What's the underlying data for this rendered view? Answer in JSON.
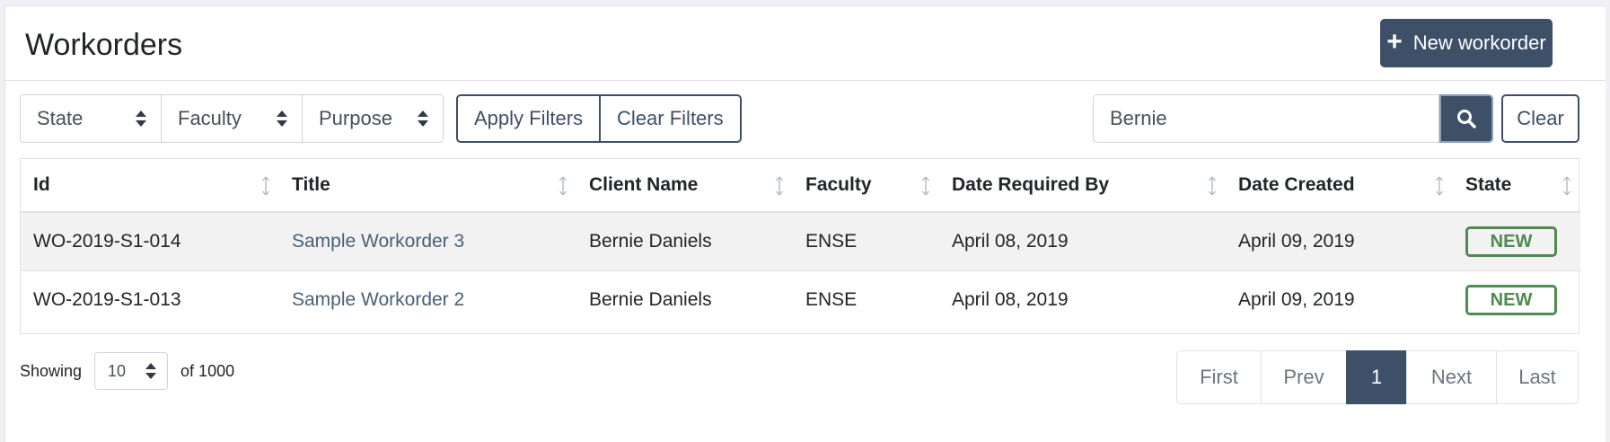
{
  "header": {
    "title": "Workorders",
    "new_button": "New workorder"
  },
  "filters": {
    "state": "State",
    "faculty": "Faculty",
    "purpose": "Purpose",
    "apply": "Apply Filters",
    "clear": "Clear Filters"
  },
  "search": {
    "value": "Bernie",
    "clear": "Clear"
  },
  "table": {
    "columns": [
      "Id",
      "Title",
      "Client Name",
      "Faculty",
      "Date Required By",
      "Date Created",
      "State"
    ],
    "rows": [
      {
        "id": "WO-2019-S1-014",
        "title": "Sample Workorder 3",
        "client": "Bernie Daniels",
        "faculty": "ENSE",
        "required": "April 08, 2019",
        "created": "April 09, 2019",
        "state": "NEW"
      },
      {
        "id": "WO-2019-S1-013",
        "title": "Sample Workorder 2",
        "client": "Bernie Daniels",
        "faculty": "ENSE",
        "required": "April 08, 2019",
        "created": "April 09, 2019",
        "state": "NEW"
      }
    ]
  },
  "footer": {
    "showing_label": "Showing",
    "page_size": "10",
    "total_label": "of 1000"
  },
  "pagination": {
    "first": "First",
    "prev": "Prev",
    "current": "1",
    "next": "Next",
    "last": "Last"
  },
  "colors": {
    "primary": "#3d5068",
    "state_new": "#4f8a50"
  }
}
